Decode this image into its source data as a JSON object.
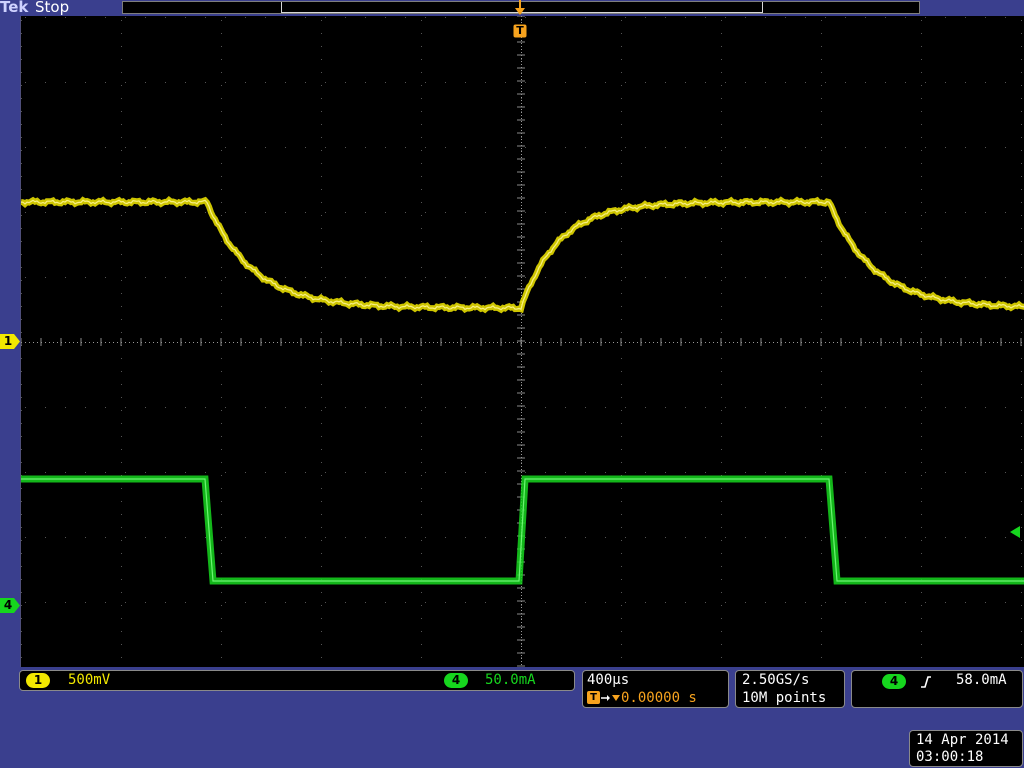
{
  "header": {
    "brand": "Tek",
    "run_state": "Stop"
  },
  "markers": {
    "trigger_top": "T",
    "ch1": "1",
    "ch4": "4"
  },
  "vertical": {
    "ch1_number": "1",
    "ch1_scale": "500mV",
    "ch4_number": "4",
    "ch4_scale": "50.0mA"
  },
  "horizontal": {
    "timebase": "400µs",
    "trigger_icon": "T",
    "trigger_delay": "0.00000 s"
  },
  "acquisition": {
    "sample_rate": "2.50GS/s",
    "record_length": "10M points"
  },
  "trigger": {
    "source": "4",
    "slope_icon": "rising-edge-icon",
    "level": "58.0mA"
  },
  "datetime": {
    "date": "14 Apr 2014",
    "time": "03:00:18"
  },
  "colors": {
    "ch1": "#f2e800",
    "ch4": "#16d61e",
    "trigger": "#f7a31e",
    "frame": "#3a3f8e"
  }
}
